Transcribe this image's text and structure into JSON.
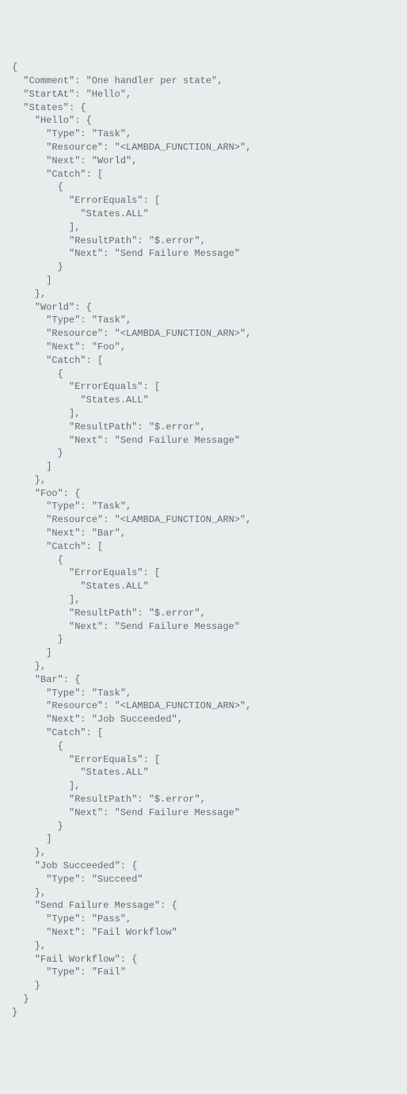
{
  "code": "{\n  \"Comment\": \"One handler per state\",\n  \"StartAt\": \"Hello\",\n  \"States\": {\n    \"Hello\": {\n      \"Type\": \"Task\",\n      \"Resource\": \"<LAMBDA_FUNCTION_ARN>\",\n      \"Next\": \"World\",\n      \"Catch\": [\n        {\n          \"ErrorEquals\": [\n            \"States.ALL\"\n          ],\n          \"ResultPath\": \"$.error\",\n          \"Next\": \"Send Failure Message\"\n        }\n      ]\n    },\n    \"World\": {\n      \"Type\": \"Task\",\n      \"Resource\": \"<LAMBDA_FUNCTION_ARN>\",\n      \"Next\": \"Foo\",\n      \"Catch\": [\n        {\n          \"ErrorEquals\": [\n            \"States.ALL\"\n          ],\n          \"ResultPath\": \"$.error\",\n          \"Next\": \"Send Failure Message\"\n        }\n      ]\n    },\n    \"Foo\": {\n      \"Type\": \"Task\",\n      \"Resource\": \"<LAMBDA_FUNCTION_ARN>\",\n      \"Next\": \"Bar\",\n      \"Catch\": [\n        {\n          \"ErrorEquals\": [\n            \"States.ALL\"\n          ],\n          \"ResultPath\": \"$.error\",\n          \"Next\": \"Send Failure Message\"\n        }\n      ]\n    },\n    \"Bar\": {\n      \"Type\": \"Task\",\n      \"Resource\": \"<LAMBDA_FUNCTION_ARN>\",\n      \"Next\": \"Job Succeeded\",\n      \"Catch\": [\n        {\n          \"ErrorEquals\": [\n            \"States.ALL\"\n          ],\n          \"ResultPath\": \"$.error\",\n          \"Next\": \"Send Failure Message\"\n        }\n      ]\n    },\n    \"Job Succeeded\": {\n      \"Type\": \"Succeed\"\n    },\n    \"Send Failure Message\": {\n      \"Type\": \"Pass\",\n      \"Next\": \"Fail Workflow\"\n    },\n    \"Fail Workflow\": {\n      \"Type\": \"Fail\"\n    }\n  }\n}"
}
